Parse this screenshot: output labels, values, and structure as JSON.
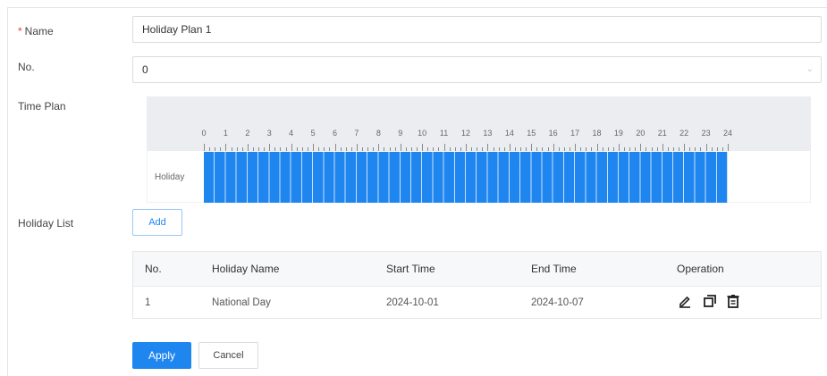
{
  "form": {
    "name_label": "Name",
    "required_mark": "*",
    "name_value": "Holiday Plan 1",
    "no_label": "No.",
    "no_value": "0",
    "no_arrow_icon": "chevron-down-icon",
    "time_plan_label": "Time Plan",
    "holiday_list_label": "Holiday List"
  },
  "time_plan": {
    "hours": [
      "0",
      "1",
      "2",
      "3",
      "4",
      "5",
      "6",
      "7",
      "8",
      "9",
      "10",
      "11",
      "12",
      "13",
      "14",
      "15",
      "16",
      "17",
      "18",
      "19",
      "20",
      "21",
      "22",
      "23",
      "24"
    ],
    "row_label": "Holiday",
    "bar_color": "#1f86f0",
    "coverage_start_hour": 0,
    "coverage_end_hour": 24
  },
  "add_button_label": "Add",
  "table": {
    "headers": [
      "No.",
      "Holiday Name",
      "Start Time",
      "End Time",
      "Operation"
    ],
    "rows": [
      {
        "no": "1",
        "name": "National Day",
        "start": "2024-10-01",
        "end": "2024-10-07"
      }
    ],
    "operation_icons": [
      "edit-icon",
      "copy-icon",
      "delete-icon"
    ]
  },
  "buttons": {
    "apply": "Apply",
    "cancel": "Cancel"
  },
  "colors": {
    "accent": "#1f86f0",
    "required": "#e04040"
  }
}
